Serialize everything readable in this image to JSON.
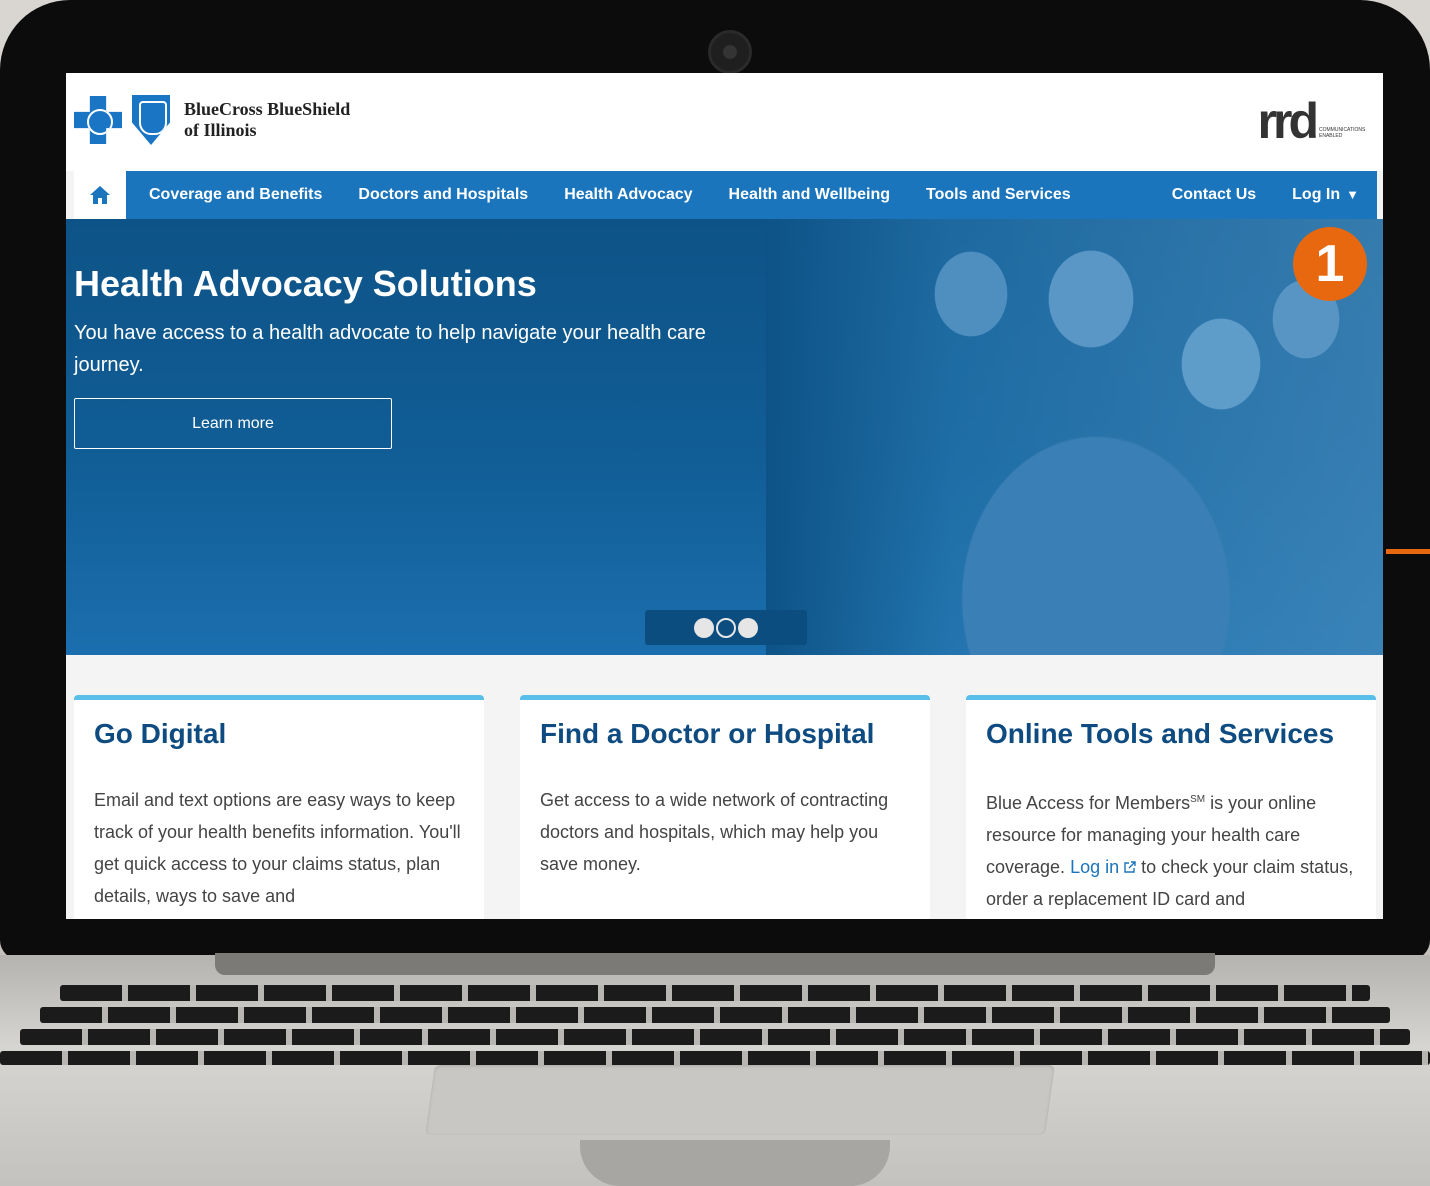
{
  "brand": {
    "name_line1": "BlueCross BlueShield",
    "name_line2": "of Illinois"
  },
  "partner_logo": {
    "mark": "rrd",
    "tagline": "COMMUNICATIONS ENABLED"
  },
  "nav": {
    "home_icon": "home-icon",
    "items": [
      "Coverage and Benefits",
      "Doctors and Hospitals",
      "Health Advocacy",
      "Health and Wellbeing",
      "Tools and Services"
    ],
    "contact": "Contact Us",
    "login": "Log In",
    "login_caret": "▼"
  },
  "hero": {
    "title": "Health Advocacy Solutions",
    "text": "You have access to a health advocate to help navigate your health care journey.",
    "button": "Learn more",
    "slides": {
      "count": 3,
      "active": [
        1,
        3
      ]
    }
  },
  "annotation": {
    "number": "1",
    "color": "#e8680f"
  },
  "cards": [
    {
      "title": "Go Digital",
      "text": "Email and text options are easy ways to keep track of your health benefits information. You'll get quick access to your claims status, plan details, ways to save and"
    },
    {
      "title": "Find a Doctor or Hospital",
      "text": "Get access to a wide network of contracting doctors and hospitals, which may help you save money."
    },
    {
      "title": "Online Tools and Services",
      "text_pre": "Blue Access for Members",
      "text_sup": "SM",
      "text_mid": " is your online resource for managing your health care coverage. ",
      "link": "Log in",
      "link_icon": "external-link-icon",
      "text_post": " to check your claim status, order a replacement ID card and"
    }
  ],
  "colors": {
    "nav": "#1b75bc",
    "hero": "#115d96",
    "card_heading": "#0e4b80",
    "card_accent": "#58c0e8"
  }
}
